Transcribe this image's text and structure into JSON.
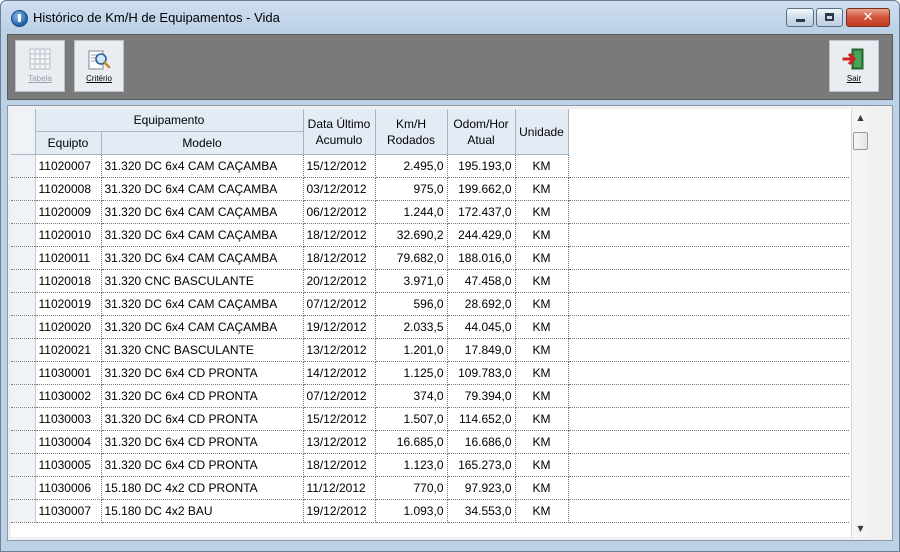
{
  "window": {
    "title": "Histórico de Km/H de Equipamentos - Vida",
    "minimize_glyph": "",
    "maximize_glyph": "",
    "close_glyph": "✕"
  },
  "toolbar": {
    "tabela_label": "Tabela",
    "criterio_label": "Critério",
    "sair_label": "Sair",
    "icons": {
      "tabela": "grid-icon",
      "criterio": "magnifier-icon",
      "sair": "exit-door-icon"
    }
  },
  "grid": {
    "group_header": "Equipamento",
    "columns": [
      "Equipto",
      "Modelo",
      "Data Último Acumulo",
      "Km/H Rodados",
      "Odom/Hor Atual",
      "Unidade"
    ],
    "rows": [
      [
        "11020007",
        "31.320 DC 6x4 CAM CAÇAMBA",
        "15/12/2012",
        "2.495,0",
        "195.193,0",
        "KM"
      ],
      [
        "11020008",
        "31.320 DC 6x4 CAM CAÇAMBA",
        "03/12/2012",
        "975,0",
        "199.662,0",
        "KM"
      ],
      [
        "11020009",
        "31.320 DC 6x4 CAM CAÇAMBA",
        "06/12/2012",
        "1.244,0",
        "172.437,0",
        "KM"
      ],
      [
        "11020010",
        "31.320 DC 6x4 CAM CAÇAMBA",
        "18/12/2012",
        "32.690,2",
        "244.429,0",
        "KM"
      ],
      [
        "11020011",
        "31.320 DC 6x4 CAM CAÇAMBA",
        "18/12/2012",
        "79.682,0",
        "188.016,0",
        "KM"
      ],
      [
        "11020018",
        "31.320 CNC BASCULANTE",
        "20/12/2012",
        "3.971,0",
        "47.458,0",
        "KM"
      ],
      [
        "11020019",
        "31.320 DC 6x4 CAM CAÇAMBA",
        "07/12/2012",
        "596,0",
        "28.692,0",
        "KM"
      ],
      [
        "11020020",
        "31.320 DC 6x4 CAM CAÇAMBA",
        "19/12/2012",
        "2.033,5",
        "44.045,0",
        "KM"
      ],
      [
        "11020021",
        "31.320 CNC BASCULANTE",
        "13/12/2012",
        "1.201,0",
        "17.849,0",
        "KM"
      ],
      [
        "11030001",
        "31.320 DC 6x4 CD PRONTA",
        "14/12/2012",
        "1.125,0",
        "109.783,0",
        "KM"
      ],
      [
        "11030002",
        "31.320 DC 6x4 CD PRONTA",
        "07/12/2012",
        "374,0",
        "79.394,0",
        "KM"
      ],
      [
        "11030003",
        "31.320 DC 6x4 CD PRONTA",
        "15/12/2012",
        "1.507,0",
        "114.652,0",
        "KM"
      ],
      [
        "11030004",
        "31.320 DC 6x4 CD PRONTA",
        "13/12/2012",
        "16.685,0",
        "16.686,0",
        "KM"
      ],
      [
        "11030005",
        "31.320 DC 6x4 CD PRONTA",
        "18/12/2012",
        "1.123,0",
        "165.273,0",
        "KM"
      ],
      [
        "11030006",
        "15.180 DC 4x2 CD PRONTA",
        "11/12/2012",
        "770,0",
        "97.923,0",
        "KM"
      ],
      [
        "11030007",
        "15.180 DC 4x2 BAU",
        "19/12/2012",
        "1.093,0",
        "34.553,0",
        "KM"
      ]
    ]
  },
  "scrollbar": {
    "up_glyph": "▲",
    "down_glyph": "▼",
    "position": 0.0
  }
}
